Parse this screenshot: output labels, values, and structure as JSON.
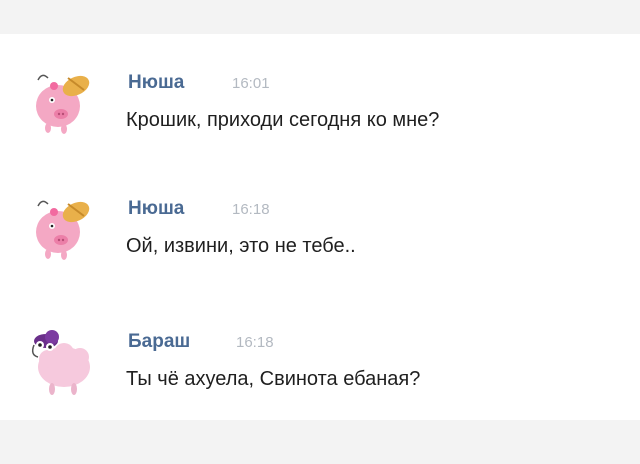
{
  "messages": [
    {
      "author": "Нюша",
      "time": "16:01",
      "text": "Крошик, приходи сегодня ко мне?",
      "avatar": "nyusha-pig-avatar"
    },
    {
      "author": "Нюша",
      "time": "16:18",
      "text": "Ой, извини, это не тебе..",
      "avatar": "nyusha-pig-avatar"
    },
    {
      "author": "Бараш",
      "time": "16:18",
      "text": "Ты чё ахуела, Свинота ебаная?",
      "avatar": "barash-sheep-avatar"
    }
  ],
  "colors": {
    "author_name": "#4a6a93",
    "timestamp": "#b3b9c1",
    "message_text": "#1f1f1f",
    "background": "#ffffff"
  }
}
